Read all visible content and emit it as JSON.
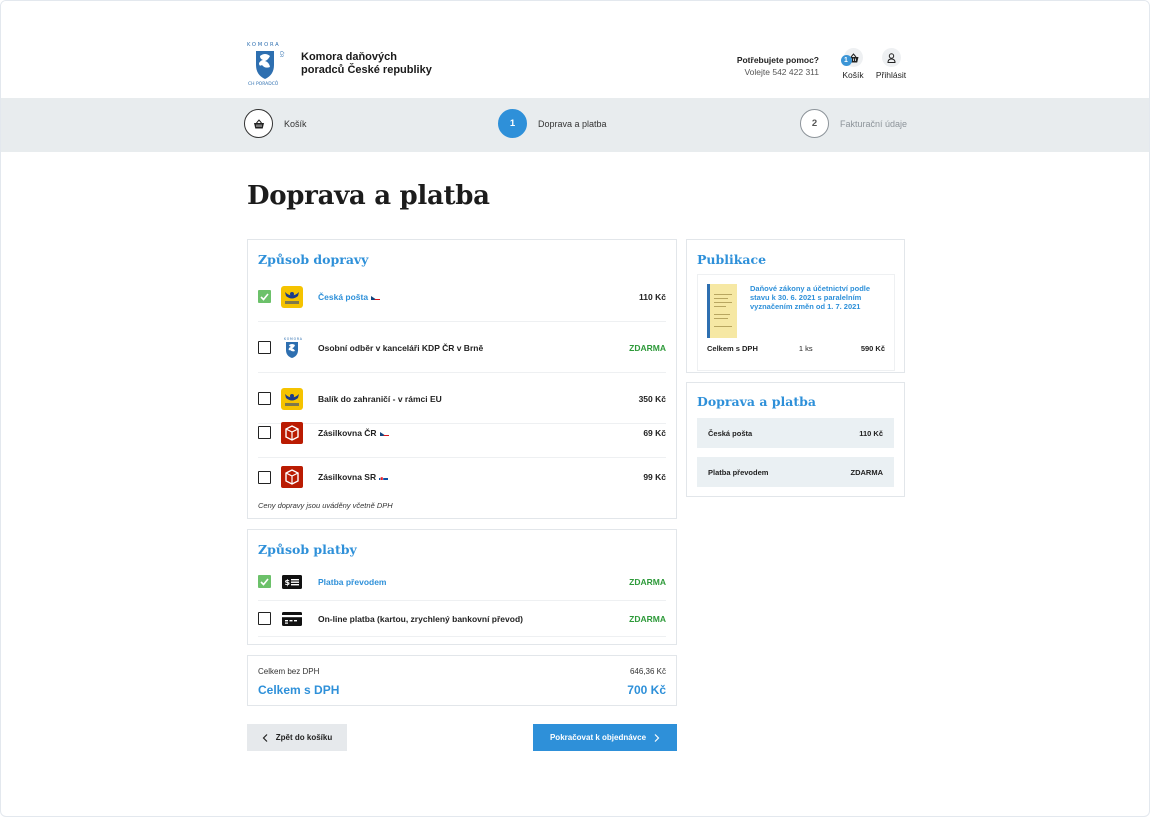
{
  "header": {
    "logo_text": "KOMORA DAŇOVÝCH PORADCŮ ČR",
    "brand_line1": "Komora daňových",
    "brand_line2": "poradců České republiky",
    "help_question": "Potřebujete pomoc?",
    "help_phone": "Volejte 542 422 311",
    "cart_label": "Košík",
    "cart_count": "1",
    "login_label": "Přihlásit"
  },
  "steps": [
    {
      "label": "Košík",
      "number": "",
      "state": "done"
    },
    {
      "label": "Doprava a platba",
      "number": "1",
      "state": "active"
    },
    {
      "label": "Fakturační údaje",
      "number": "2",
      "state": "inactive"
    }
  ],
  "page_title": "Doprava a platba",
  "shipping": {
    "title": "Způsob dopravy",
    "options": [
      {
        "label": "Česká pošta",
        "price": "110 Kč",
        "checked": true,
        "icon": "ceska-posta-icon",
        "flag": "cz"
      },
      {
        "label": "Osobní odběr v kanceláři KDP ČR v Brně",
        "price": "ZDARMA",
        "checked": false,
        "icon": "kdp-logo-icon",
        "flag": ""
      },
      {
        "label": "Balík do zahraničí - v rámci EU",
        "price": "350 Kč",
        "checked": false,
        "icon": "ceska-posta-icon",
        "flag": ""
      },
      {
        "label": "Zásilkovna ČR",
        "price": "69 Kč",
        "checked": false,
        "icon": "zasilkovna-icon",
        "flag": "cz"
      },
      {
        "label": "Zásilkovna SR",
        "price": "99 Kč",
        "checked": false,
        "icon": "zasilkovna-icon",
        "flag": "sk"
      }
    ],
    "note": "Ceny dopravy jsou uváděny včetně DPH"
  },
  "payment": {
    "title": "Způsob platby",
    "options": [
      {
        "label": "Platba převodem",
        "price": "ZDARMA",
        "checked": true,
        "icon": "money-transfer-icon"
      },
      {
        "label": "On-line platba (kartou, zrychlený bankovní převod)",
        "price": "ZDARMA",
        "checked": false,
        "icon": "card-payment-icon"
      }
    ]
  },
  "totals": {
    "without_vat_label": "Celkem bez DPH",
    "without_vat_value": "646,36 Kč",
    "with_vat_label": "Celkem s DPH",
    "with_vat_value": "700 Kč"
  },
  "buttons": {
    "back": "Zpět do košíku",
    "next": "Pokračovat k objednávce"
  },
  "sidebar": {
    "publications_title": "Publikace",
    "publication": {
      "title": "Daňové zákony a účetnictví podle stavu k 30. 6. 2021 s paralelním vyznačením změn od 1. 7. 2021",
      "price_label": "Celkem s DPH",
      "quantity": "1 ks",
      "price": "590 Kč"
    },
    "summary_title": "Doprava a platba",
    "summary": [
      {
        "label": "Česká pošta",
        "value": "110 Kč"
      },
      {
        "label": "Platba převodem",
        "value": "ZDARMA"
      }
    ]
  },
  "colors": {
    "accent": "#2e90d9",
    "free": "#2e9a3a",
    "checked": "#6cc16a"
  }
}
